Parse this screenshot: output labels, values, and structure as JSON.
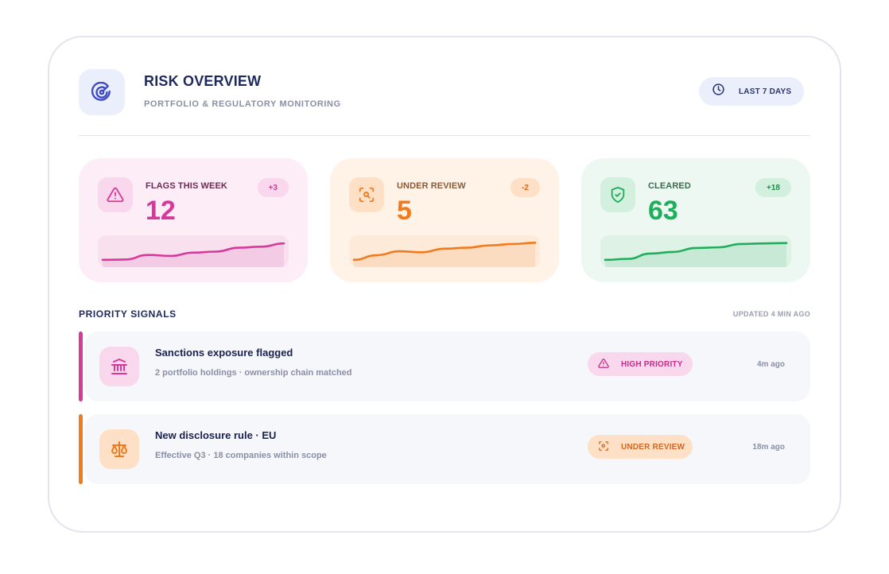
{
  "header": {
    "title": "RISK OVERVIEW",
    "subtitle": "PORTFOLIO & REGULATORY MONITORING",
    "icon": "radar-icon",
    "range_label": "LAST 7 DAYS",
    "range_icon": "clock-icon"
  },
  "stats": [
    {
      "label": "FLAGS THIS WEEK",
      "value": "12",
      "delta": "+3",
      "icon": "warning-triangle-icon",
      "color": "#d6399a",
      "bg": "#fcedf6",
      "icon_bg": "#f9d7ec",
      "badge_bg": "#f9d7ec",
      "trend": [
        3,
        3.1,
        4.5,
        4.2,
        5.2,
        5.5,
        6.7,
        7.0,
        8.0
      ]
    },
    {
      "label": "UNDER REVIEW",
      "value": "5",
      "delta": "-2",
      "icon": "scan-search-icon",
      "color": "#f07a1c",
      "bg": "#fff3e8",
      "icon_bg": "#fde0c6",
      "badge_bg": "#fde0c6",
      "label_color": "#8a5a36",
      "trend": [
        3,
        4.4,
        5.6,
        5.3,
        6.4,
        6.7,
        7.4,
        7.8,
        8.2
      ]
    },
    {
      "label": "CLEARED",
      "value": "63",
      "delta": "+18",
      "icon": "shield-check-icon",
      "color": "#1fae5b",
      "bg": "#eef8f2",
      "icon_bg": "#d3f0de",
      "badge_bg": "#d3f0de",
      "label_color": "#3d6a4f",
      "trend": [
        3,
        3.3,
        4.9,
        5.4,
        6.6,
        6.8,
        7.8,
        8.0,
        8.1
      ]
    }
  ],
  "signals": {
    "title": "PRIORITY SIGNALS",
    "updated": "UPDATED 4 MIN AGO",
    "items": [
      {
        "title": "Sanctions exposure flagged",
        "subtitle": "2 portfolio holdings · ownership chain matched",
        "badge": "HIGH PRIORITY",
        "badge_icon": "warning-triangle-icon",
        "time": "4m ago",
        "icon": "bank-icon",
        "color": "#d6399a",
        "icon_bg": "#f9d7ec",
        "badge_bg": "#f9d7ec"
      },
      {
        "title": "New disclosure rule · EU",
        "subtitle": "Effective Q3 · 18 companies within scope",
        "badge": "UNDER REVIEW",
        "badge_icon": "scan-search-icon",
        "time": "18m ago",
        "icon": "scale-icon",
        "color": "#f07a1c",
        "icon_bg": "#fde0c6",
        "badge_bg": "#fde0c6"
      }
    ]
  }
}
